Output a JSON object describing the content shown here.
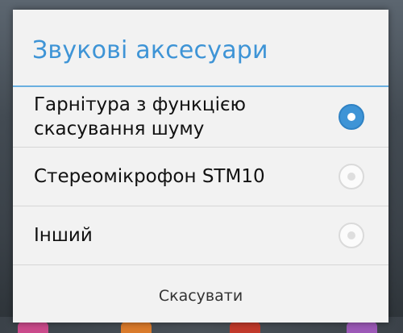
{
  "dialog": {
    "title": "Звукові аксесуари",
    "options": [
      {
        "label": "Гарнітура з функцією скасування шуму",
        "selected": true
      },
      {
        "label": "Стереомікрофон STM10",
        "selected": false
      },
      {
        "label": "Інший",
        "selected": false
      }
    ],
    "cancel_label": "Скасувати"
  },
  "colors": {
    "accent": "#3e94d6",
    "dialog_background": "#f2f2f2"
  }
}
